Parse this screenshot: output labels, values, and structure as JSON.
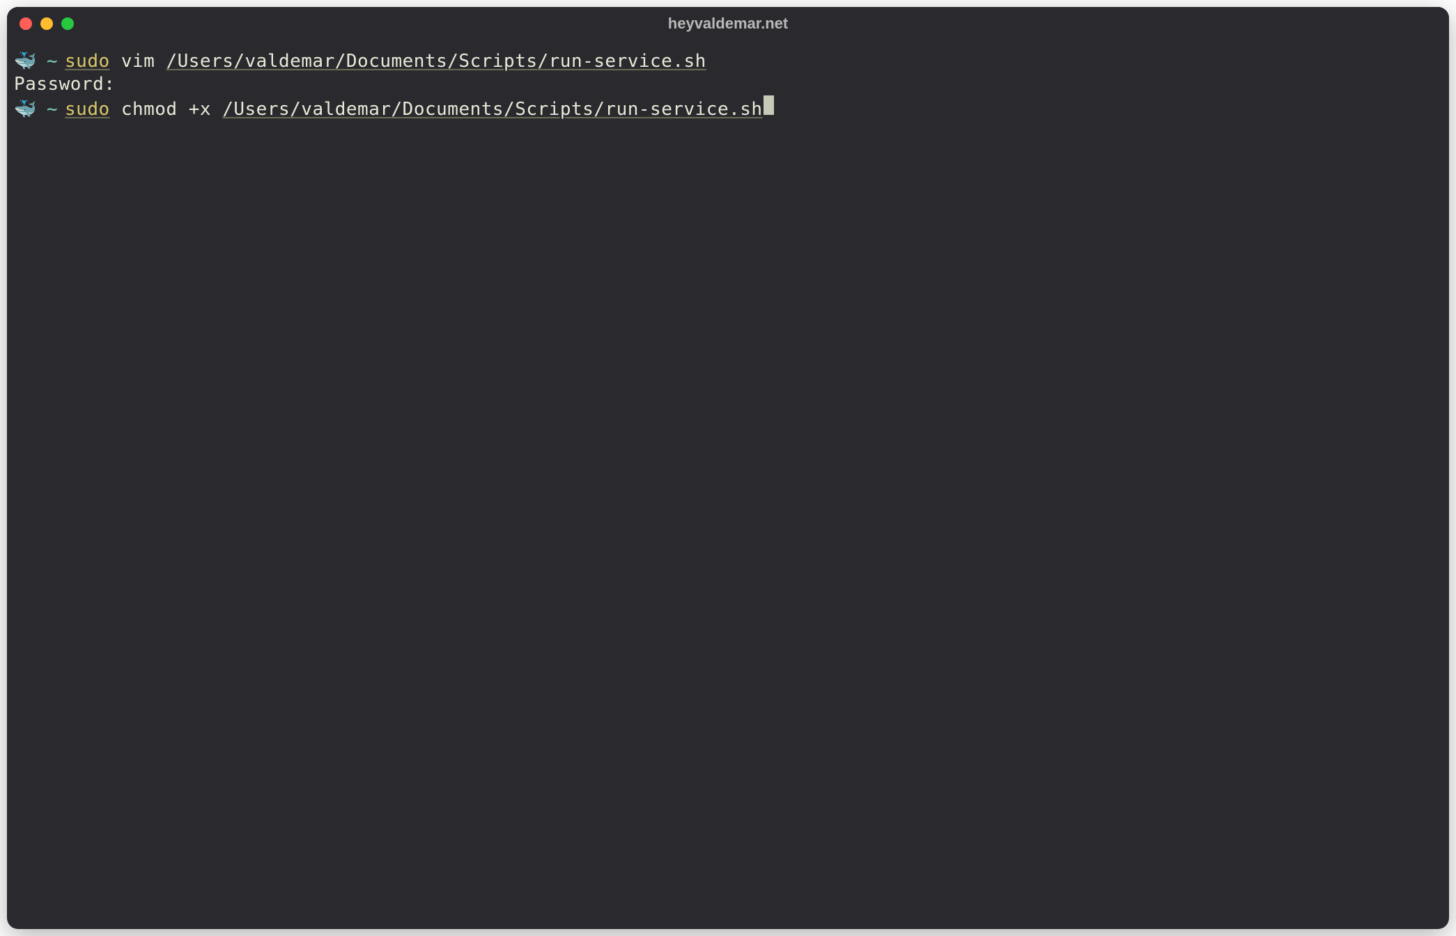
{
  "window": {
    "title": "heyvaldemar.net"
  },
  "prompt": {
    "icon": "🐳",
    "tilde": "~"
  },
  "lines": {
    "line1": {
      "sudo": "sudo",
      "command": "vim",
      "path": "/Users/valdemar/Documents/Scripts/run-service.sh"
    },
    "line2": {
      "text": "Password:"
    },
    "line3": {
      "sudo": "sudo",
      "command": "chmod",
      "arg": "+x",
      "path": "/Users/valdemar/Documents/Scripts/run-service.sh"
    }
  }
}
